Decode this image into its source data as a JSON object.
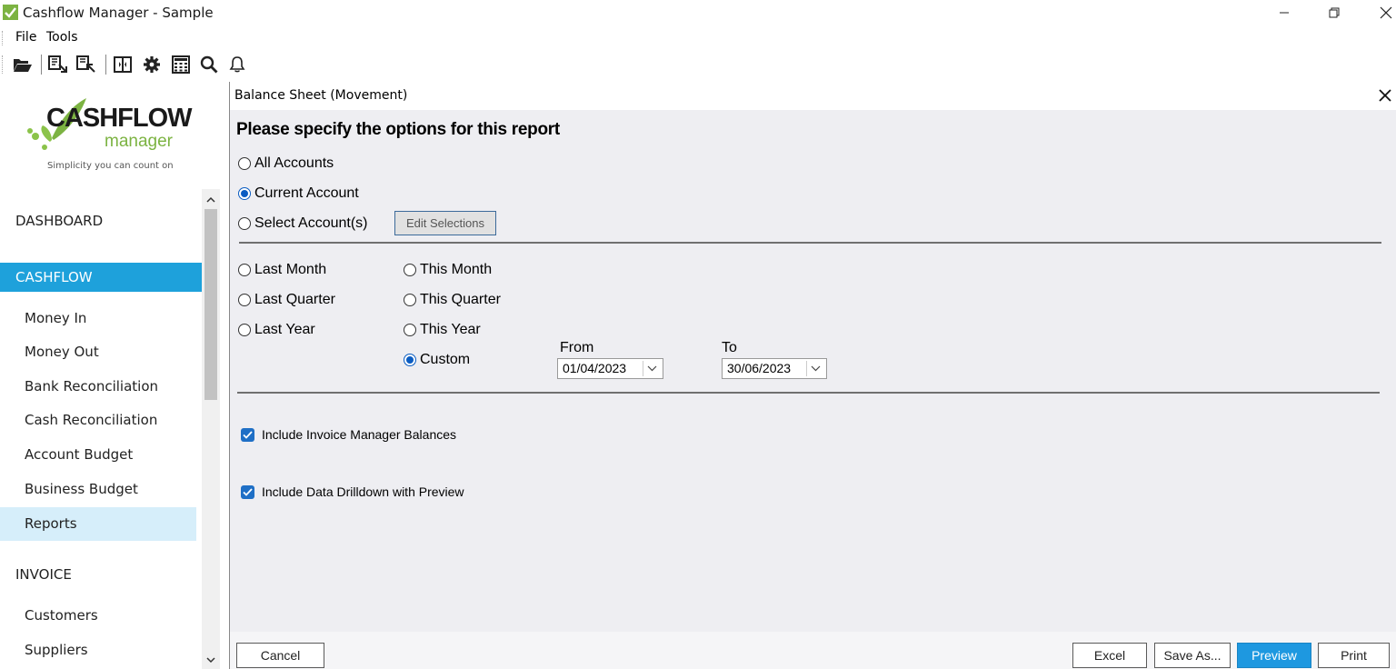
{
  "window": {
    "title": "Cashflow Manager - Sample"
  },
  "menu": {
    "file": "File",
    "tools": "Tools"
  },
  "toolbar": {
    "icons": [
      "folder-open-icon",
      "backup-icon",
      "restore-icon",
      "panel-toggle-icon",
      "gear-icon",
      "calculator-icon",
      "search-icon",
      "bell-icon"
    ]
  },
  "logo": {
    "name": "CASHFLOW",
    "sub": "manager",
    "tagline": "Simplicity you can count on",
    "accent": "#7cb342"
  },
  "sidebar": {
    "dashboard": "DASHBOARD",
    "cashflow": "CASHFLOW",
    "cashflow_items": [
      "Money In",
      "Money Out",
      "Bank Reconciliation",
      "Cash Reconciliation",
      "Account Budget",
      "Business Budget",
      "Reports"
    ],
    "invoice": "INVOICE",
    "invoice_items": [
      "Customers",
      "Suppliers"
    ],
    "active_color": "#1ea1db",
    "selected_color": "#d6eefa"
  },
  "dialog": {
    "title": "Balance Sheet (Movement)",
    "heading": "Please specify the options for this report",
    "accounts": {
      "all": "All Accounts",
      "current": "Current Account",
      "select": "Select Account(s)",
      "edit_selections": "Edit Selections",
      "selected": "current"
    },
    "periods": {
      "last_month": "Last Month",
      "last_quarter": "Last Quarter",
      "last_year": "Last Year",
      "this_month": "This Month",
      "this_quarter": "This Quarter",
      "this_year": "This Year",
      "custom": "Custom",
      "selected": "custom"
    },
    "dates": {
      "from_label": "From",
      "from_value": "01/04/2023",
      "to_label": "To",
      "to_value": "30/06/2023"
    },
    "options": {
      "include_invoice": "Include Invoice Manager Balances",
      "include_invoice_checked": true,
      "include_drilldown": "Include Data Drilldown with Preview",
      "include_drilldown_checked": true
    },
    "buttons": {
      "cancel": "Cancel",
      "excel": "Excel",
      "save_as": "Save As...",
      "preview": "Preview",
      "print": "Print"
    }
  }
}
